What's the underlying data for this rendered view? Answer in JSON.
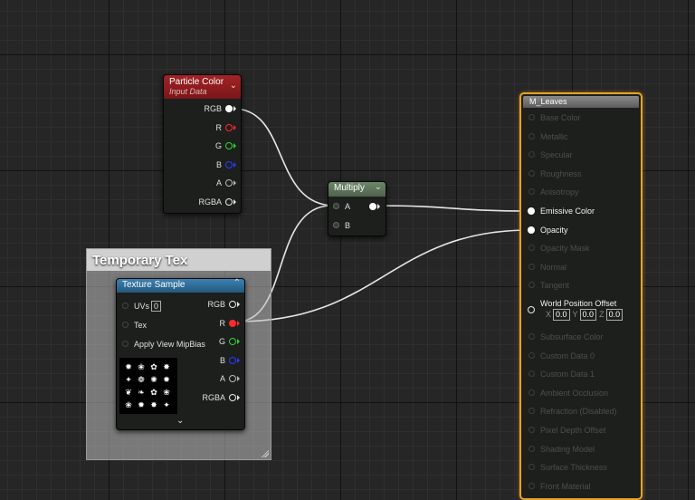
{
  "comment_box": {
    "title": "Temporary Tex"
  },
  "particle_color": {
    "title": "Particle Color",
    "subtitle": "Input Data",
    "outputs": [
      {
        "label": "RGB",
        "color": "#ffffff"
      },
      {
        "label": "R",
        "color": "#ff2a2a"
      },
      {
        "label": "G",
        "color": "#35d235"
      },
      {
        "label": "B",
        "color": "#2a3cff"
      },
      {
        "label": "A",
        "color": "#b8b8b8"
      },
      {
        "label": "RGBA",
        "color": "#e8e8e8"
      }
    ]
  },
  "multiply": {
    "title": "Multiply",
    "inputs": [
      {
        "label": "A"
      },
      {
        "label": "B"
      }
    ]
  },
  "texture_sample": {
    "title": "Texture Sample",
    "uvs_label": "UVs",
    "uvs_value": "0",
    "tex_label": "Tex",
    "mipbias_label": "Apply View MipBias",
    "outputs": [
      {
        "label": "RGB",
        "color": "#e8e8e8"
      },
      {
        "label": "R",
        "color": "#ff2a2a"
      },
      {
        "label": "G",
        "color": "#35d235"
      },
      {
        "label": "B",
        "color": "#2a3cff"
      },
      {
        "label": "A",
        "color": "#b8b8b8"
      },
      {
        "label": "RGBA",
        "color": "#e8e8e8"
      }
    ]
  },
  "material": {
    "title": "M_Leaves",
    "inputs": [
      {
        "label": "Base Color",
        "active": false
      },
      {
        "label": "Metallic",
        "active": false
      },
      {
        "label": "Specular",
        "active": false
      },
      {
        "label": "Roughness",
        "active": false
      },
      {
        "label": "Anisotropy",
        "active": false
      },
      {
        "label": "Emissive Color",
        "active": true
      },
      {
        "label": "Opacity",
        "active": true
      },
      {
        "label": "Opacity Mask",
        "active": false
      },
      {
        "label": "Normal",
        "active": false
      },
      {
        "label": "Tangent",
        "active": false
      },
      {
        "label": "World Position Offset",
        "active": true
      },
      {
        "label": "Subsurface Color",
        "active": false
      },
      {
        "label": "Custom Data 0",
        "active": false
      },
      {
        "label": "Custom Data 1",
        "active": false
      },
      {
        "label": "Ambient Occlusion",
        "active": false
      },
      {
        "label": "Refraction (Disabled)",
        "active": false
      },
      {
        "label": "Pixel Depth Offset",
        "active": false
      },
      {
        "label": "Shading Model",
        "active": false
      },
      {
        "label": "Surface Thickness",
        "active": false
      },
      {
        "label": "Front Material",
        "active": false
      }
    ],
    "wpo": {
      "x_label": "X",
      "x": "0.0",
      "y_label": "Y",
      "y": "0.0",
      "z_label": "Z",
      "z": "0.0"
    }
  },
  "colors": {
    "particle_header": "#8e1d20",
    "multiply_header": "#5c7258",
    "texture_header": "#2d6c96",
    "material_border": "#e8a227",
    "wire": "#e6e6e6"
  }
}
